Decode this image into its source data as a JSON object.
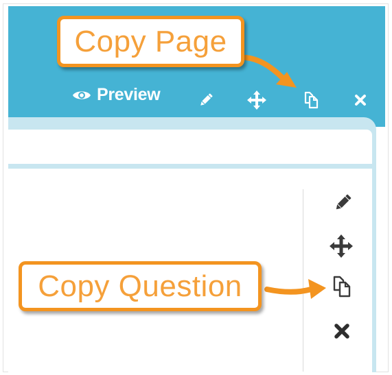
{
  "toolbar": {
    "preview_label": "Preview",
    "icons": [
      "eye-icon",
      "pencil-icon",
      "move-icon",
      "copy-icon",
      "close-icon"
    ]
  },
  "question_actions": {
    "icons": [
      "pencil-icon",
      "move-icon",
      "copy-icon",
      "close-icon"
    ]
  },
  "callouts": {
    "copy_page": "Copy Page",
    "copy_question": "Copy Question"
  },
  "colors": {
    "header": "#45b3d4",
    "panel": "#c8e6f0",
    "callout_border": "#f39420",
    "callout_text": "#f5a03a",
    "icon_dark": "#3a3a3a"
  }
}
